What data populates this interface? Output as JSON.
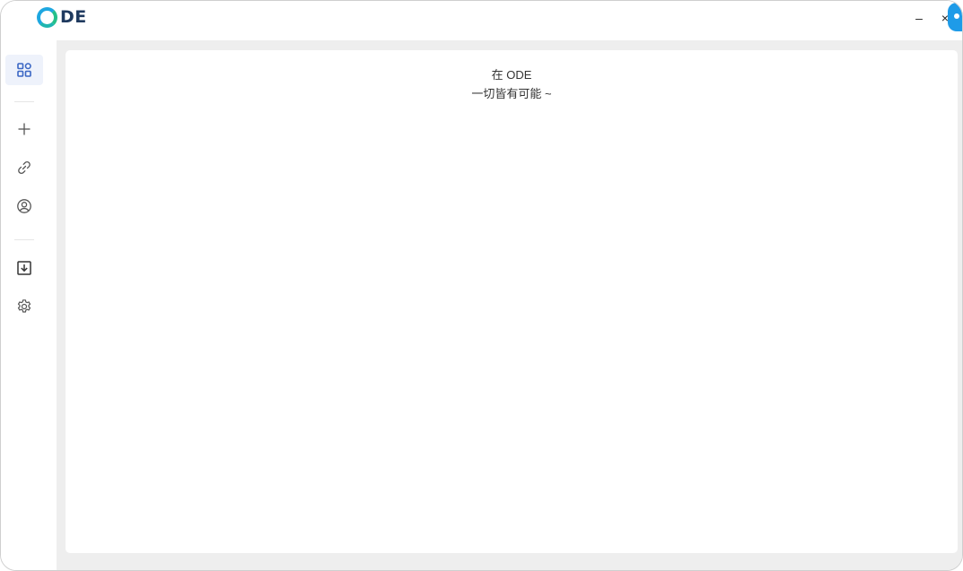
{
  "app": {
    "logo_text": "DE",
    "minimize_label": "–",
    "close_label": "×"
  },
  "sidebar": {
    "items": [
      {
        "name": "dashboard",
        "icon": "grid-icon",
        "active": true
      },
      {
        "name": "add",
        "icon": "plus-icon",
        "active": false
      },
      {
        "name": "link",
        "icon": "link-icon",
        "active": false
      },
      {
        "name": "user",
        "icon": "user-circle-icon",
        "active": false
      },
      {
        "name": "download",
        "icon": "download-box-icon",
        "active": false
      },
      {
        "name": "settings",
        "icon": "gear-icon",
        "active": false
      }
    ]
  },
  "main": {
    "title": "在 ODE",
    "subtitle": "一切皆有可能 ~"
  },
  "colors": {
    "accent": "#3a66c4",
    "logo_ring_blue": "#1ea7e0",
    "logo_ring_green": "#24c08a",
    "logo_text": "#1f3a5f",
    "content_bg": "#eeeeee",
    "active_item_bg": "#eef2fb"
  }
}
